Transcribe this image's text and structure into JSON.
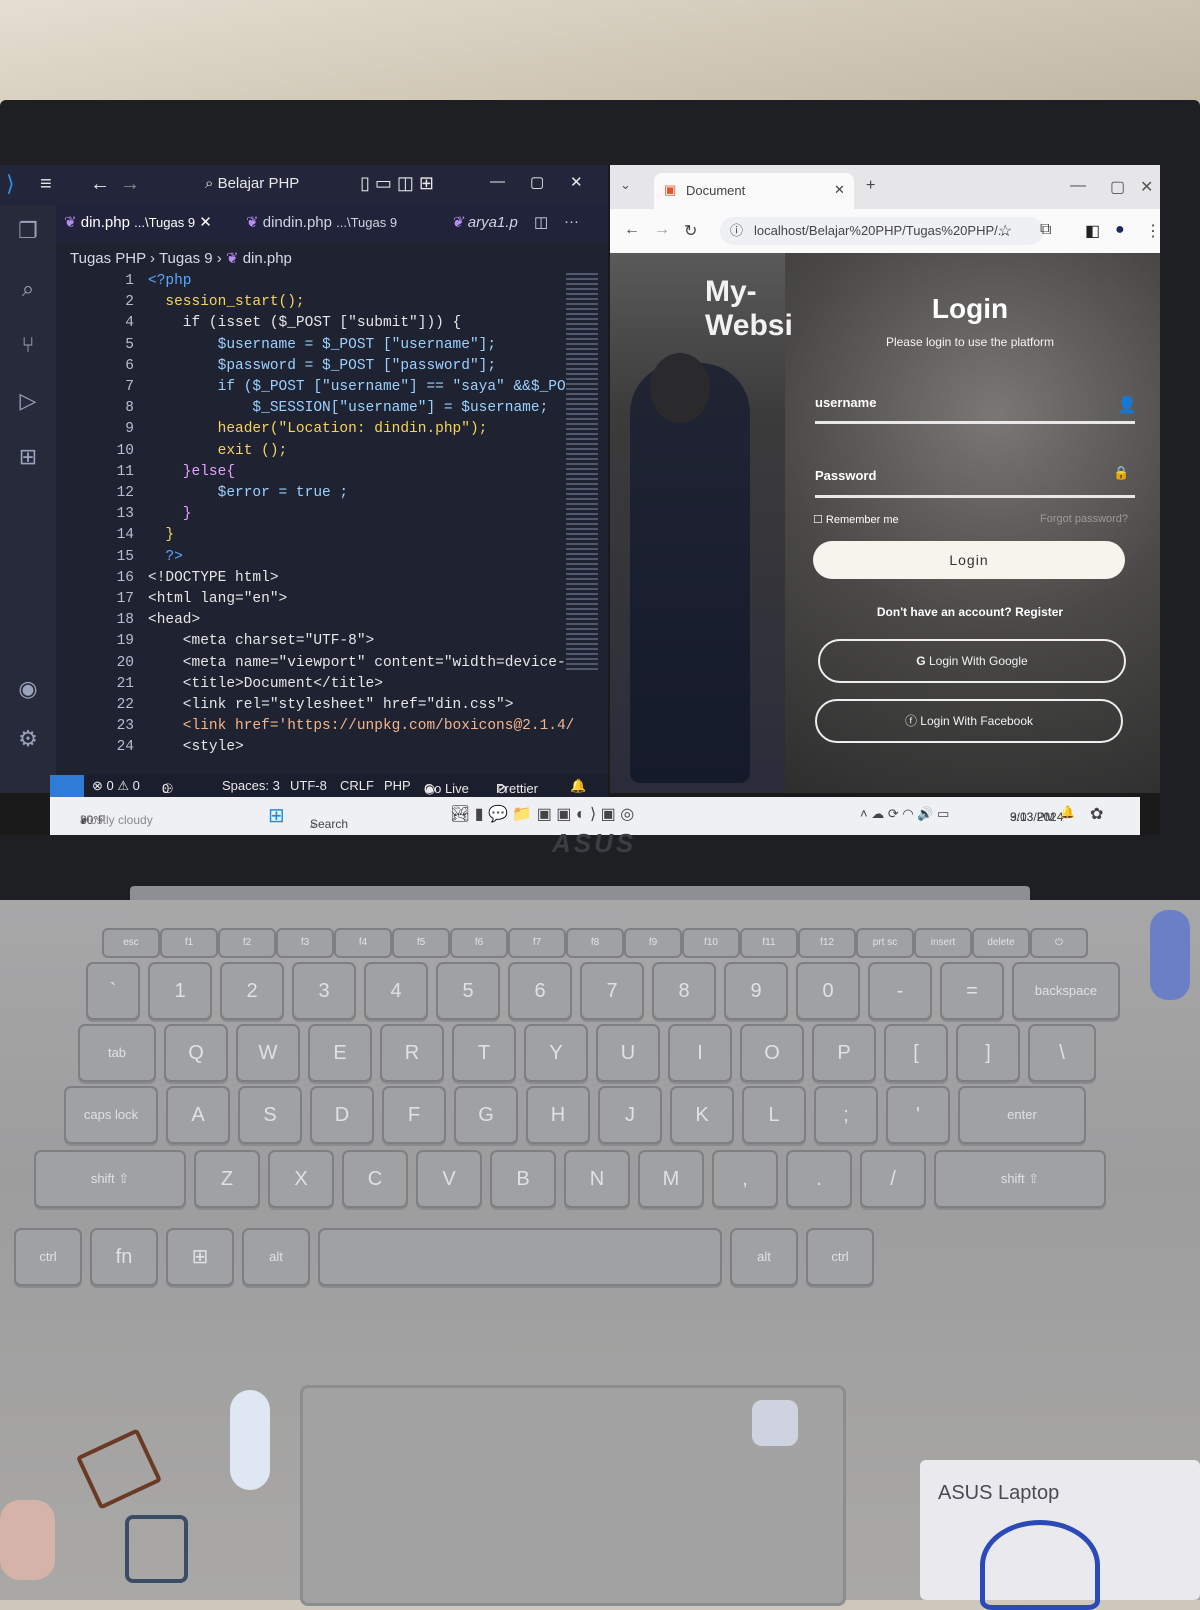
{
  "vscode": {
    "search_text": "Belajar PHP",
    "tabs": [
      {
        "label": "din.php",
        "path": "...\\Tugas 9",
        "close": "✕"
      },
      {
        "label": "dindin.php",
        "path": "...\\Tugas 9"
      },
      {
        "label": "arya1.p"
      }
    ],
    "breadcrumb": [
      "Tugas PHP",
      "Tugas 9",
      "din.php"
    ],
    "code_lines": [
      {
        "n": "1",
        "text": "<?php",
        "color": "#5aa9ff"
      },
      {
        "n": "2",
        "text": "  session_start();",
        "color": "#f4d35e"
      },
      {
        "n": "4",
        "text": "    if (isset ($_POST [\"submit\"])) {",
        "color": "#e6e6e6"
      },
      {
        "n": "5",
        "text": "        $username = $_POST [\"username\"];",
        "color": "#9ad1ff"
      },
      {
        "n": "6",
        "text": "        $password = $_POST [\"password\"];",
        "color": "#9ad1ff"
      },
      {
        "n": "7",
        "text": "        if ($_POST [\"username\"] == \"saya\" &&$_PO",
        "color": "#9ad1ff"
      },
      {
        "n": "8",
        "text": "            $_SESSION[\"username\"] = $username;",
        "color": "#9ad1ff"
      },
      {
        "n": "9",
        "text": "        header(\"Location: dindin.php\");",
        "color": "#f4d35e"
      },
      {
        "n": "10",
        "text": "        exit ();",
        "color": "#f4d35e"
      },
      {
        "n": "11",
        "text": "    }else{",
        "color": "#e6a0ff"
      },
      {
        "n": "12",
        "text": "        $error = true ;",
        "color": "#9ad1ff"
      },
      {
        "n": "13",
        "text": "    }",
        "color": "#e6a0ff"
      },
      {
        "n": "14",
        "text": "  }",
        "color": "#f4d35e"
      },
      {
        "n": "15",
        "text": "  ?>",
        "color": "#5aa9ff"
      },
      {
        "n": "16",
        "text": "<!DOCTYPE html>",
        "color": "#e6e6e6"
      },
      {
        "n": "17",
        "text": "<html lang=\"en\">",
        "color": "#e6e6e6"
      },
      {
        "n": "18",
        "text": "<head>",
        "color": "#e6e6e6"
      },
      {
        "n": "19",
        "text": "    <meta charset=\"UTF-8\">",
        "color": "#e6e6e6"
      },
      {
        "n": "20",
        "text": "    <meta name=\"viewport\" content=\"width=device-",
        "color": "#e6e6e6"
      },
      {
        "n": "21",
        "text": "    <title>Document</title>",
        "color": "#e6e6e6"
      },
      {
        "n": "22",
        "text": "    <link rel=\"stylesheet\" href=\"din.css\">",
        "color": "#e6e6e6"
      },
      {
        "n": "23",
        "text": "    <link href='https://unpkg.com/boxicons@2.1.4/",
        "color": "#f2b48b"
      },
      {
        "n": "24",
        "text": "    <style>",
        "color": "#e6e6e6"
      }
    ],
    "status": {
      "errors": "⊗ 0 ⚠ 0",
      "ports": "0",
      "spaces": "Spaces: 3",
      "encoding": "UTF-8",
      "eol": "CRLF",
      "language": "PHP",
      "golive": "Go Live",
      "prettier": "Prettier"
    }
  },
  "chrome": {
    "tab_title": "Document",
    "url": "localhost/Belajar%20PHP/Tugas%20PHP/..."
  },
  "website": {
    "brand": "My-\nWebsi",
    "title": "Login",
    "subtitle": "Please login to use the platform",
    "username_label": "username",
    "password_label": "Password",
    "remember": "Remember me",
    "forgot": "Forgot password?",
    "login_button": "Login",
    "register_text": "Don't have an account? Register",
    "google_button": "Login With Google",
    "facebook_button": "Login With Facebook"
  },
  "taskbar": {
    "weather_temp": "80°F",
    "weather_desc": "Mostly cloudy",
    "search": "Search",
    "time": "9:03 PM",
    "date": "3/13/2024"
  },
  "device": {
    "brand_logo": "ASUS",
    "sticker_text": "ASUS Laptop"
  },
  "keyboard": {
    "fn_row": [
      "esc",
      "f1",
      "f2",
      "f3",
      "f4",
      "f5",
      "f6",
      "f7",
      "f8",
      "f9",
      "f10",
      "f11",
      "f12",
      "prt sc",
      "insert",
      "delete",
      "⏻"
    ],
    "number_row": [
      "`",
      "1",
      "2",
      "3",
      "4",
      "5",
      "6",
      "7",
      "8",
      "9",
      "0",
      "-",
      "=",
      "backspace"
    ],
    "q_row": [
      "tab",
      "Q",
      "W",
      "E",
      "R",
      "T",
      "Y",
      "U",
      "I",
      "O",
      "P",
      "[",
      "]",
      "\\"
    ],
    "a_row": [
      "caps lock",
      "A",
      "S",
      "D",
      "F",
      "G",
      "H",
      "J",
      "K",
      "L",
      ";",
      "'",
      "enter"
    ],
    "z_row": [
      "shift ⇧",
      "Z",
      "X",
      "C",
      "V",
      "B",
      "N",
      "M",
      ",",
      ".",
      "/",
      "shift ⇧"
    ],
    "bottom_row": [
      "ctrl",
      "fn",
      "⊞",
      "alt",
      "",
      "alt",
      "ctrl"
    ]
  }
}
